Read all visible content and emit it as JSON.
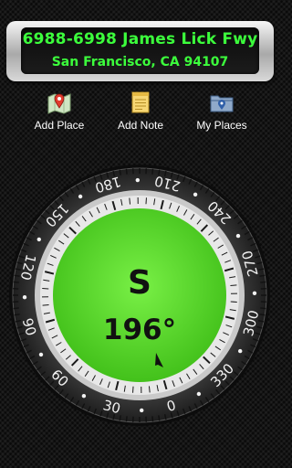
{
  "address": {
    "street": "6988-6998 James Lick Fwy",
    "city": "San Francisco, CA 94107"
  },
  "toolbar": [
    {
      "label": "Add Place",
      "icon": "map-pin-icon"
    },
    {
      "label": "Add Note",
      "icon": "note-icon"
    },
    {
      "label": "My Places",
      "icon": "folder-icon"
    }
  ],
  "compass": {
    "direction": "S",
    "heading_text": "196°",
    "heading_deg": 196,
    "bezel_labels": [
      "0",
      "30",
      "60",
      "90",
      "120",
      "150",
      "180",
      "210",
      "240",
      "270",
      "300",
      "330"
    ],
    "colors": {
      "dial": "#5ee52a",
      "bezel": "#2d2d2d",
      "text": "#111111"
    }
  }
}
